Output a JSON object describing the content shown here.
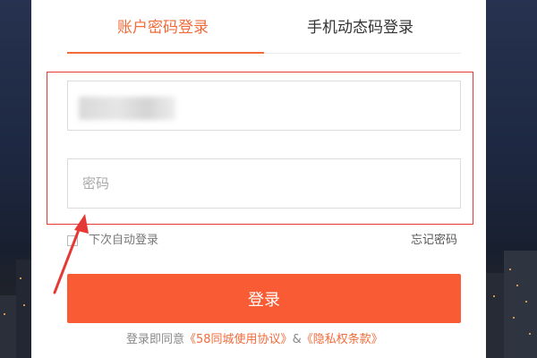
{
  "tabs": [
    {
      "label": "账户密码登录",
      "active": true
    },
    {
      "label": "手机动态码登录",
      "active": false
    }
  ],
  "form": {
    "username_value": "",
    "password_placeholder": "密码",
    "remember_label": "下次自动登录",
    "forgot_label": "忘记密码",
    "login_label": "登录"
  },
  "agreement": {
    "prefix": "登录即同意",
    "user_agreement": "《58同城使用协议》",
    "separator": "&",
    "privacy_policy": "《隐私权条款》"
  },
  "colors": {
    "accent": "#f16b3b",
    "button": "#f95c34",
    "annotation_red": "#e53935"
  },
  "icons": {
    "annotation": "red-arrow-icon"
  }
}
